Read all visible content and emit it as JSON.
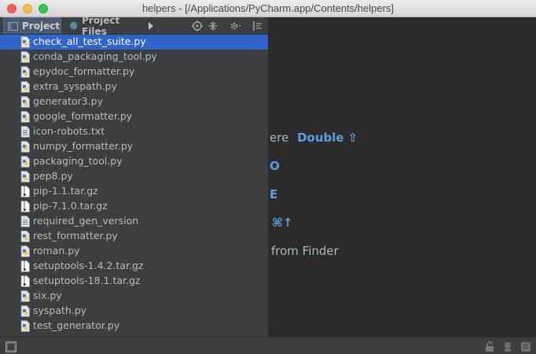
{
  "window": {
    "title": "helpers - [/Applications/PyCharm.app/Contents/helpers]"
  },
  "panel": {
    "tabs": [
      {
        "label": "Project",
        "active": true
      },
      {
        "label": "Project Files",
        "active": false
      }
    ]
  },
  "files": [
    {
      "name": "check_all_test_suite.py",
      "type": "python",
      "selected": true
    },
    {
      "name": "conda_packaging_tool.py",
      "type": "python"
    },
    {
      "name": "epydoc_formatter.py",
      "type": "python"
    },
    {
      "name": "extra_syspath.py",
      "type": "python"
    },
    {
      "name": "generator3.py",
      "type": "python"
    },
    {
      "name": "google_formatter.py",
      "type": "python"
    },
    {
      "name": "icon-robots.txt",
      "type": "text"
    },
    {
      "name": "numpy_formatter.py",
      "type": "python"
    },
    {
      "name": "packaging_tool.py",
      "type": "python"
    },
    {
      "name": "pep8.py",
      "type": "python"
    },
    {
      "name": "pip-1.1.tar.gz",
      "type": "archive"
    },
    {
      "name": "pip-7.1.0.tar.gz",
      "type": "archive"
    },
    {
      "name": "required_gen_version",
      "type": "text"
    },
    {
      "name": "rest_formatter.py",
      "type": "python"
    },
    {
      "name": "roman.py",
      "type": "python"
    },
    {
      "name": "setuptools-1.4.2.tar.gz",
      "type": "archive"
    },
    {
      "name": "setuptools-18.1.tar.gz",
      "type": "archive"
    },
    {
      "name": "six.py",
      "type": "python"
    },
    {
      "name": "syspath.py",
      "type": "python"
    },
    {
      "name": "test_generator.py",
      "type": "python"
    }
  ],
  "editor_hints": {
    "line1_text": "ere",
    "line1_key": "Double ⇧",
    "line2_key": "O",
    "line3_key": "E",
    "line4_key": "⌘↑",
    "line5_text": "from Finder"
  },
  "colors": {
    "selection": "#2f65ca",
    "accent_key": "#5a9fe0",
    "panel_bg": "#3c3f41",
    "editor_bg": "#2b2b2b"
  }
}
